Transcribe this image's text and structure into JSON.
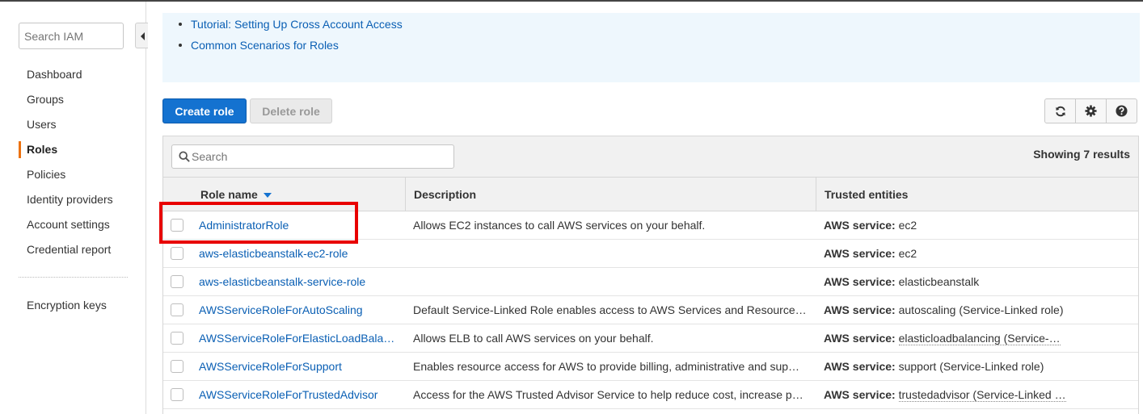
{
  "sidebar": {
    "search_placeholder": "Search IAM",
    "items": [
      {
        "label": "Dashboard"
      },
      {
        "label": "Groups"
      },
      {
        "label": "Users"
      },
      {
        "label": "Roles",
        "active": true
      },
      {
        "label": "Policies"
      },
      {
        "label": "Identity providers"
      },
      {
        "label": "Account settings"
      },
      {
        "label": "Credential report"
      }
    ],
    "encryption_label": "Encryption keys"
  },
  "info_links": [
    {
      "label": "Tutorial: Setting Up Cross Account Access"
    },
    {
      "label": "Common Scenarios for Roles"
    }
  ],
  "toolbar": {
    "create_label": "Create role",
    "delete_label": "Delete role",
    "icons": [
      "refresh-icon",
      "gear-icon",
      "help-icon"
    ]
  },
  "table": {
    "search_placeholder": "Search",
    "showing": "Showing 7 results",
    "columns": {
      "name": "Role name",
      "description": "Description",
      "trusted": "Trusted entities"
    },
    "trusted_prefix": "AWS service:",
    "rows": [
      {
        "name": "AdministratorRole",
        "description": "Allows EC2 instances to call AWS services on your behalf.",
        "trusted": "ec2"
      },
      {
        "name": "aws-elasticbeanstalk-ec2-role",
        "description": "",
        "trusted": "ec2"
      },
      {
        "name": "aws-elasticbeanstalk-service-role",
        "description": "",
        "trusted": "elasticbeanstalk"
      },
      {
        "name": "AWSServiceRoleForAutoScaling",
        "description": "Default Service-Linked Role enables access to AWS Services and Resource…",
        "trusted": "autoscaling (Service-Linked role)"
      },
      {
        "name": "AWSServiceRoleForElasticLoadBala…",
        "description": "Allows ELB to call AWS services on your behalf.",
        "trusted": "elasticloadbalancing (Service-…"
      },
      {
        "name": "AWSServiceRoleForSupport",
        "description": "Enables resource access for AWS to provide billing, administrative and sup…",
        "trusted": "support (Service-Linked role)"
      },
      {
        "name": "AWSServiceRoleForTrustedAdvisor",
        "description": "Access for the AWS Trusted Advisor Service to help reduce cost, increase p…",
        "trusted": "trustedadvisor (Service-Linked …"
      }
    ]
  },
  "colors": {
    "accent": "#1472d0",
    "link": "#0a5fb4",
    "active_nav": "#ec7211",
    "highlight": "#e80000"
  }
}
